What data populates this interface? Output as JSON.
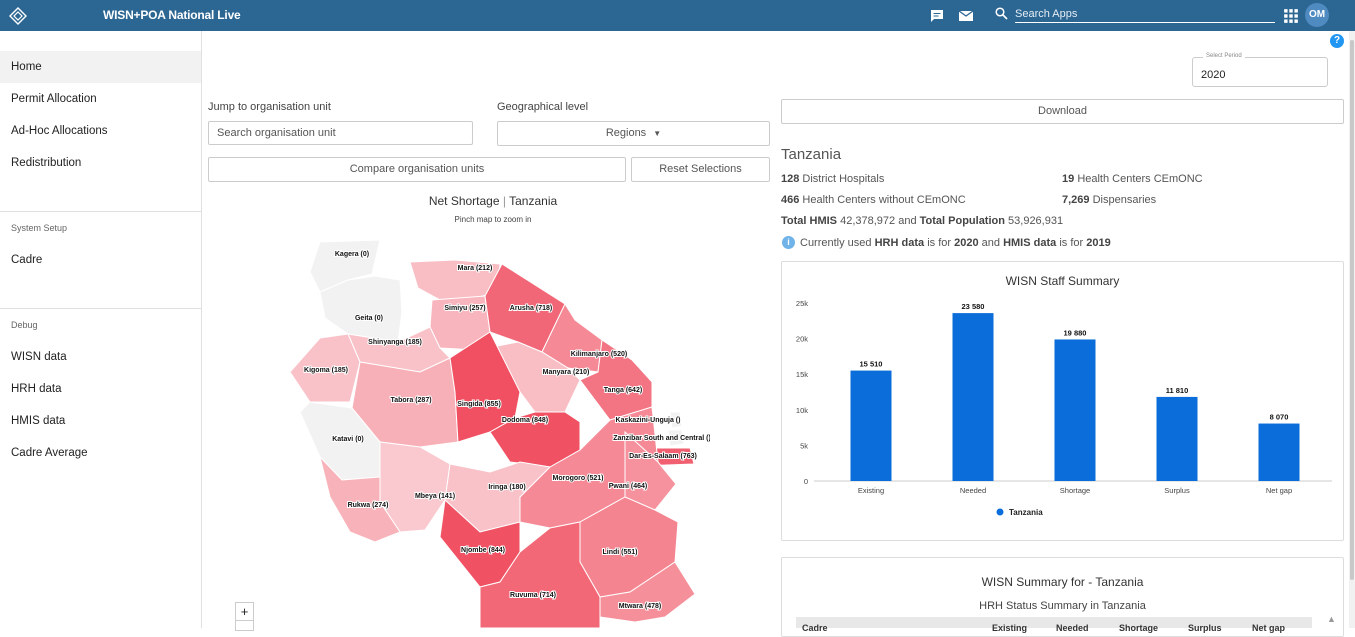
{
  "app": {
    "title": "WISN+POA National Live",
    "user_initials": "OM"
  },
  "search": {
    "placeholder": "Search Apps"
  },
  "sidebar": {
    "items": [
      {
        "label": "Home"
      },
      {
        "label": "Permit Allocation"
      },
      {
        "label": "Ad-Hoc Allocations"
      },
      {
        "label": "Redistribution"
      }
    ],
    "system_setup": {
      "title": "System Setup",
      "items": [
        {
          "label": "Cadre"
        }
      ]
    },
    "debug": {
      "title": "Debug",
      "items": [
        {
          "label": "WISN data"
        },
        {
          "label": "HRH data"
        },
        {
          "label": "HMIS data"
        },
        {
          "label": "Cadre Average"
        }
      ]
    }
  },
  "period": {
    "label": "Select Period",
    "value": "2020"
  },
  "controls": {
    "jump_label": "Jump to organisation unit",
    "search_placeholder": "Search organisation unit",
    "geo_label": "Geographical level",
    "geo_value": "Regions",
    "compare_label": "Compare organisation units",
    "reset_label": "Reset Selections",
    "download_label": "Download"
  },
  "map": {
    "title": "Net Shortage",
    "title_sep": "|",
    "country": "Tanzania",
    "subtitle": "Pinch map to zoom in",
    "zoom_in": "+",
    "regions": [
      {
        "label": "Kagera (0)",
        "shade": 0
      },
      {
        "label": "Mara (212)",
        "shade": 212
      },
      {
        "label": "Simiyu (257)",
        "shade": 257
      },
      {
        "label": "Arusha (718)",
        "shade": 718
      },
      {
        "label": "Geita (0)",
        "shade": 0
      },
      {
        "label": "Shinyanga (185)",
        "shade": 185
      },
      {
        "label": "Kilimanjaro (520)",
        "shade": 520
      },
      {
        "label": "Kigoma (185)",
        "shade": 185
      },
      {
        "label": "Manyara (210)",
        "shade": 210
      },
      {
        "label": "Tabora (287)",
        "shade": 287
      },
      {
        "label": "Singida (855)",
        "shade": 855
      },
      {
        "label": "Tanga (642)",
        "shade": 642
      },
      {
        "label": "Dodoma (848)",
        "shade": 848
      },
      {
        "label": "Kaskazini-Unguja ()",
        "shade": 0
      },
      {
        "label": "Katavi (0)",
        "shade": 0
      },
      {
        "label": "Zanzibar South and Central ()",
        "shade": 0
      },
      {
        "label": "Dar-Es-Salaam (763)",
        "shade": 763
      },
      {
        "label": "Morogoro (521)",
        "shade": 521
      },
      {
        "label": "Pwani (464)",
        "shade": 464
      },
      {
        "label": "Mbeya (141)",
        "shade": 141
      },
      {
        "label": "Iringa (180)",
        "shade": 180
      },
      {
        "label": "Rukwa (274)",
        "shade": 274
      },
      {
        "label": "Njombe (844)",
        "shade": 844
      },
      {
        "label": "Lindi (551)",
        "shade": 551
      },
      {
        "label": "Ruvuma (714)",
        "shade": 714
      },
      {
        "label": "Mtwara (478)",
        "shade": 478
      }
    ]
  },
  "summary": {
    "country": "Tanzania",
    "district_hospitals_num": "128",
    "district_hospitals_label": "District Hospitals",
    "hc_cemonc_num": "19",
    "hc_cemonc_label": "Health Centers CEmONC",
    "hc_without_num": "466",
    "hc_without_label": "Health Centers without CEmONC",
    "dispensaries_num": "7,269",
    "dispensaries_label": "Dispensaries",
    "total_hmis_label": "Total HMIS",
    "total_hmis_value": "42,378,972",
    "and_label": "and",
    "total_pop_label": "Total Population",
    "total_pop_value": "53,926,931",
    "info_prefix": "Currently used",
    "hrh_data": "HRH data",
    "info_mid": "is for",
    "hrh_year": "2020",
    "hmis_data": "HMIS data",
    "hmis_year": "2019"
  },
  "chart_data": {
    "type": "bar",
    "title": "WISN Staff Summary",
    "categories": [
      "Existing",
      "Needed",
      "Shortage",
      "Surplus",
      "Net gap"
    ],
    "series": [
      {
        "name": "Tanzania",
        "values": [
          15510,
          23580,
          19880,
          11810,
          8070
        ],
        "labels": [
          "15 510",
          "23 580",
          "19 880",
          "11 810",
          "8 070"
        ]
      }
    ],
    "yticks": [
      "0",
      "5k",
      "10k",
      "15k",
      "20k",
      "25k"
    ],
    "ylim": [
      0,
      25000
    ],
    "bar_color": "#0a6dd9",
    "legend": "bottom",
    "grid": false
  },
  "table_card": {
    "title": "WISN Summary for - Tanzania",
    "subtitle": "HRH Status Summary in Tanzania",
    "headers": [
      "Cadre",
      "Existing",
      "Needed",
      "Shortage",
      "Surplus",
      "Net gap"
    ]
  },
  "colors": {
    "topbar": "#2c6693",
    "accent": "#0a6dd9"
  }
}
